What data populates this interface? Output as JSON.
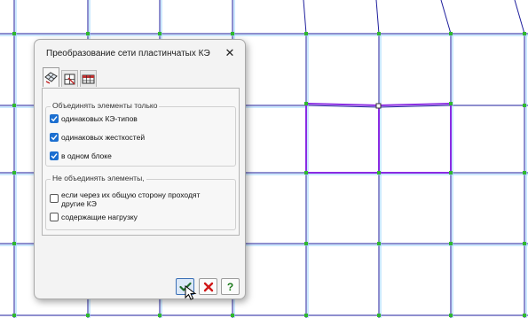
{
  "dialog": {
    "title": "Преобразование сети пластинчатых КЭ",
    "close_symbol": "✕",
    "tabs": [
      {
        "icon": "plate-mesh-icon",
        "active": true
      },
      {
        "icon": "mesh-select-icon",
        "active": false
      },
      {
        "icon": "grid-table-icon",
        "active": false
      }
    ],
    "group1": {
      "label": "Объединять элементы только",
      "options": [
        {
          "label": "одинаковых КЭ-типов",
          "checked": true
        },
        {
          "label": "одинаковых жесткостей",
          "checked": true
        },
        {
          "label": "в одном блоке",
          "checked": true
        }
      ]
    },
    "group2": {
      "label": "Не объединять элементы,",
      "options": [
        {
          "label_line1": "если через их общую сторону проходят",
          "label_line2": "другие КЭ",
          "checked": false
        },
        {
          "label_line1": "содержащие нагрузку",
          "checked": false
        }
      ]
    },
    "buttons": {
      "ok_icon": "checkmark-icon",
      "cancel_icon": "red-x-icon",
      "help_symbol": "?"
    }
  },
  "colors": {
    "grid_line": "#1e1e9c",
    "node": "#2fb82f",
    "highlight": "#8a2be2",
    "check_blue": "#1c6fd0"
  }
}
